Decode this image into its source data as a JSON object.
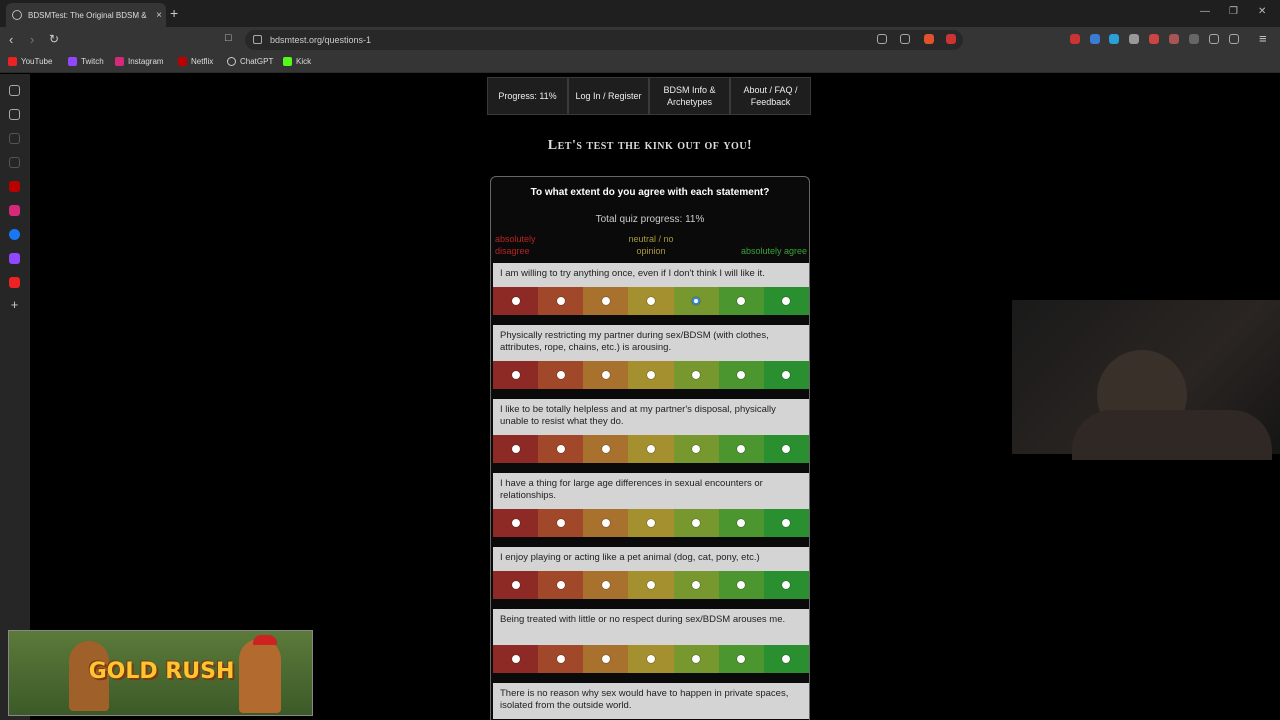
{
  "browser": {
    "tab_title": "BDSMTest: The Original BDSM &",
    "tab_close": "×",
    "new_tab": "+",
    "url": "bdsmtest.org/questions-1",
    "bookmarks": [
      "YouTube",
      "Twitch",
      "Instagram",
      "Netflix",
      "ChatGPT",
      "Kick"
    ]
  },
  "nav": {
    "progress": "Progress: 11%",
    "login": "Log In / Register",
    "info": "BDSM Info & Archetypes",
    "about": "About / FAQ / Feedback"
  },
  "slogan": "Let's test the kink out of you!",
  "quiz": {
    "heading": "To what extent do you agree with each statement?",
    "total_progress": "Total quiz progress: 11%",
    "label_left": "absolutely disagree",
    "label_mid": "neutral / no opinion",
    "label_right": "absolutely agree",
    "statements": [
      "I am willing to try anything once, even if I don't think I will like it.",
      "Physically restricting my partner during sex/BDSM (with clothes, attributes, rope, chains, etc.) is arousing.",
      "I like to be totally helpless and at my partner's disposal, physically unable to resist what they do.",
      "I have a thing for large age differences in sexual encounters or relationships.",
      "I enjoy playing or acting like a pet animal (dog, cat, pony, etc.)",
      "Being treated with little or no respect during sex/BDSM arouses me.",
      "There is no reason why sex would have to happen in private spaces, isolated from the outside world."
    ],
    "selected": [
      4,
      null,
      null,
      null,
      null,
      null,
      null
    ],
    "scale_colors": [
      "#8e2a26",
      "#a2482a",
      "#a8712e",
      "#a5902f",
      "#77982f",
      "#4c9630",
      "#2a8f2f"
    ]
  },
  "overlay": {
    "banner_text": "GOLD RUSH"
  }
}
